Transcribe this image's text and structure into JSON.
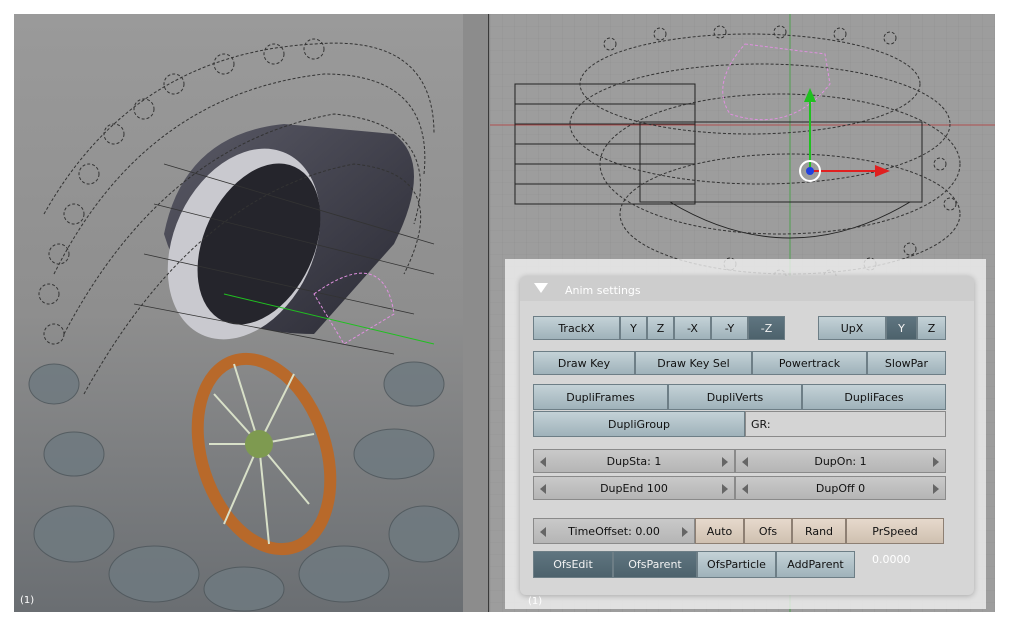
{
  "viewports": {
    "left_label": "(1)",
    "right_label": "(1)"
  },
  "panel": {
    "title": "Anim settings",
    "track": [
      "TrackX",
      "Y",
      "Z",
      "-X",
      "-Y",
      "-Z"
    ],
    "up": [
      "UpX",
      "Y",
      "Z"
    ],
    "draw": [
      "Draw Key",
      "Draw Key Sel",
      "Powertrack",
      "SlowPar"
    ],
    "dupli": [
      "DupliFrames",
      "DupliVerts",
      "DupliFaces"
    ],
    "dupligroup": "DupliGroup",
    "gr_label": "GR:",
    "dupsta": "DupSta: 1",
    "dupon": "DupOn: 1",
    "dupend": "DupEnd 100",
    "dupoff": "DupOff 0",
    "timeoffset": "TimeOffset: 0.00",
    "time_buttons": [
      "Auto",
      "Ofs",
      "Rand",
      "PrSpeed"
    ],
    "ofs_buttons": [
      "OfsEdit",
      "OfsParent",
      "OfsParticle",
      "AddParent"
    ],
    "speed_value": "0.0000"
  },
  "colors": {
    "button": "#b2c3c9",
    "button_active": "#566c76",
    "button_warm": "#dccebf",
    "axis_x": "#e02020",
    "axis_y": "#20c020",
    "axis_z": "#2040e0"
  }
}
